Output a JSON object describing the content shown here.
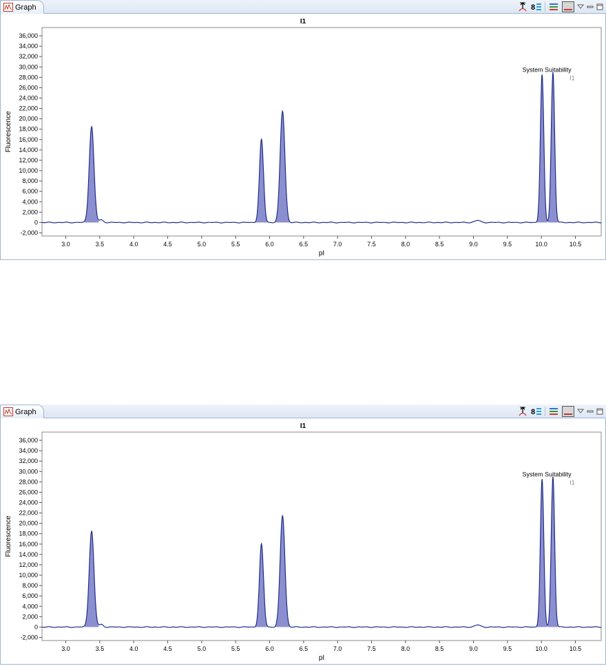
{
  "panels": [
    {
      "tab_label": "Graph",
      "toolbar": {
        "icons": [
          "align-peaks-icon",
          "legend-toggle-icon",
          "lines-icon",
          "color-fill-icon",
          "view-menu-icon",
          "minimize-icon",
          "maximize-icon"
        ]
      }
    },
    {
      "tab_label": "Graph",
      "toolbar": {
        "icons": [
          "align-peaks-icon",
          "legend-toggle-icon",
          "lines-icon",
          "color-fill-icon",
          "view-menu-icon",
          "minimize-icon",
          "maximize-icon"
        ]
      }
    }
  ],
  "colors": {
    "trace": "#1f2d8a",
    "peak_fill": "#8c8fcf",
    "frame": "#9fb4d1",
    "tab_bg": "#dde7f4"
  },
  "chart_data": [
    {
      "type": "line",
      "title": "I1",
      "xlabel": "pI",
      "ylabel": "Fluorescence",
      "xlim": [
        2.65,
        10.88
      ],
      "ylim": [
        -2600,
        37600
      ],
      "x_ticks": [
        3.0,
        3.5,
        4.0,
        4.5,
        5.0,
        5.5,
        6.0,
        6.5,
        7.0,
        7.5,
        8.0,
        8.5,
        9.0,
        9.5,
        10.0,
        10.5
      ],
      "x_tick_labels": [
        "3.0",
        "3.5",
        "4.0",
        "4.5",
        "5.0",
        "5.5",
        "6.0",
        "6.5",
        "7.0",
        "7.5",
        "8.0",
        "8.5",
        "9.0",
        "9.5",
        "10.0",
        "10.5"
      ],
      "y_ticks": [
        -2000,
        0,
        2000,
        4000,
        6000,
        8000,
        10000,
        12000,
        14000,
        16000,
        18000,
        20000,
        22000,
        24000,
        26000,
        28000,
        30000,
        32000,
        34000,
        36000
      ],
      "y_tick_labels": [
        "-2,000",
        "0",
        "2,000",
        "4,000",
        "6,000",
        "8,000",
        "10,000",
        "12,000",
        "14,000",
        "16,000",
        "18,000",
        "20,000",
        "22,000",
        "24,000",
        "26,000",
        "28,000",
        "30,000",
        "32,000",
        "34,000",
        "36,000"
      ],
      "grid": false,
      "peaks": [
        {
          "center": 3.38,
          "height": 18500,
          "width": 0.035
        },
        {
          "center": 5.88,
          "height": 16000,
          "width": 0.03
        },
        {
          "center": 6.19,
          "height": 21500,
          "width": 0.035
        },
        {
          "center": 10.01,
          "height": 28500,
          "width": 0.025
        },
        {
          "center": 10.17,
          "height": 29000,
          "width": 0.025
        }
      ],
      "minor_bumps": [
        {
          "center": 3.52,
          "height": 500,
          "width": 0.03
        },
        {
          "center": 9.06,
          "height": 400,
          "width": 0.04
        }
      ],
      "filled_peaks": [
        0,
        1,
        2,
        3,
        4
      ],
      "annotation": {
        "label": "System Suitability",
        "sublabel": "I1",
        "x": 10.08,
        "y": 28000
      }
    },
    {
      "type": "line",
      "title": "I1",
      "xlabel": "pI",
      "ylabel": "Fluorescence",
      "xlim": [
        2.65,
        10.88
      ],
      "ylim": [
        -2600,
        37600
      ],
      "x_ticks": [
        3.0,
        3.5,
        4.0,
        4.5,
        5.0,
        5.5,
        6.0,
        6.5,
        7.0,
        7.5,
        8.0,
        8.5,
        9.0,
        9.5,
        10.0,
        10.5
      ],
      "x_tick_labels": [
        "3.0",
        "3.5",
        "4.0",
        "4.5",
        "5.0",
        "5.5",
        "6.0",
        "6.5",
        "7.0",
        "7.5",
        "8.0",
        "8.5",
        "9.0",
        "9.5",
        "10.0",
        "10.5"
      ],
      "y_ticks": [
        -2000,
        0,
        2000,
        4000,
        6000,
        8000,
        10000,
        12000,
        14000,
        16000,
        18000,
        20000,
        22000,
        24000,
        26000,
        28000,
        30000,
        32000,
        34000,
        36000
      ],
      "y_tick_labels": [
        "-2,000",
        "0",
        "2,000",
        "4,000",
        "6,000",
        "8,000",
        "10,000",
        "12,000",
        "14,000",
        "16,000",
        "18,000",
        "20,000",
        "22,000",
        "24,000",
        "26,000",
        "28,000",
        "30,000",
        "32,000",
        "34,000",
        "36,000"
      ],
      "grid": false,
      "peaks": [
        {
          "center": 3.38,
          "height": 18500,
          "width": 0.035
        },
        {
          "center": 5.88,
          "height": 16000,
          "width": 0.03
        },
        {
          "center": 6.19,
          "height": 21500,
          "width": 0.035
        },
        {
          "center": 10.01,
          "height": 28500,
          "width": 0.025
        },
        {
          "center": 10.17,
          "height": 29000,
          "width": 0.025
        }
      ],
      "minor_bumps": [
        {
          "center": 3.52,
          "height": 500,
          "width": 0.03
        },
        {
          "center": 9.06,
          "height": 400,
          "width": 0.04
        }
      ],
      "filled_peaks": [
        0,
        1,
        2,
        3,
        4
      ],
      "annotation": {
        "label": "System Suitability",
        "sublabel": "I1",
        "x": 10.08,
        "y": 28000
      }
    }
  ]
}
